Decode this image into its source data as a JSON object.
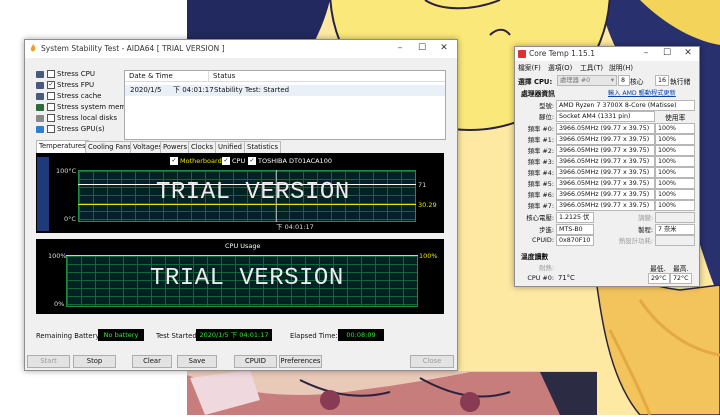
{
  "aida": {
    "title": "System Stability Test - AIDA64  [ TRIAL VERSION ]",
    "stress": [
      {
        "label": "Stress CPU",
        "checked": false
      },
      {
        "label": "Stress FPU",
        "checked": true
      },
      {
        "label": "Stress cache",
        "checked": false
      },
      {
        "label": "Stress system memory",
        "checked": false
      },
      {
        "label": "Stress local disks",
        "checked": false
      },
      {
        "label": "Stress GPU(s)",
        "checked": false
      }
    ],
    "table": {
      "col_date": "Date & Time",
      "col_status": "Status",
      "row_date": "2020/1/5",
      "row_time": "下 04:01:17",
      "row_status": "Stability Test: Started"
    },
    "tabs": [
      "Temperatures",
      "Cooling Fans",
      "Voltages",
      "Powers",
      "Clocks",
      "Unified",
      "Statistics"
    ],
    "temp_graph": {
      "legend": [
        "Motherboard",
        "CPU",
        "TOSHIBA DT01ACA100"
      ],
      "ymax": "100°C",
      "ymin": "0°C",
      "watermark": "TRIAL VERSION",
      "time": "下 04:01:17",
      "val1": "71",
      "val2": "30.29"
    },
    "cpu_graph": {
      "title": "CPU Usage",
      "ymax": "100%",
      "ymin": "0%",
      "right": "100%",
      "watermark": "TRIAL VERSION"
    },
    "bottom": {
      "battery_label": "Remaining Battery:",
      "battery_value": "No battery",
      "started_label": "Test Started:",
      "started_value": "2020/1/5   下 04:01:17",
      "elapsed_label": "Elapsed Time:",
      "elapsed_value": "00:08:09"
    },
    "buttons": {
      "start": "Start",
      "stop": "Stop",
      "clear": "Clear",
      "save": "Save",
      "cpuid": "CPUID",
      "prefs": "Preferences",
      "close": "Close"
    }
  },
  "coretemp": {
    "title": "Core Temp 1.15.1",
    "menu": [
      "檔案(F)",
      "選項(O)",
      "工具(T)",
      "說明(H)"
    ],
    "select_cpu_label": "選擇 CPU:",
    "processor_value": "處理器 #0",
    "cores": "8",
    "cores_label": "核心",
    "threads": "16",
    "threads_label": "執行緒",
    "proc_info_label": "處理器資訊",
    "driver_link": "輸入 AMD 驅動程式更新",
    "model_label": "型號:",
    "model_value": "AMD Ryzen 7 3700X 8-Core (Matisse)",
    "socket_label": "腳位:",
    "socket_value": "Socket AM4 (1331 pin)",
    "usage_label": "使用率",
    "freqs": [
      {
        "label": "頻率 #0:",
        "value": "3966.05MHz (99.77 x 39.75)",
        "usage": "100%"
      },
      {
        "label": "頻率 #1:",
        "value": "3966.05MHz (99.77 x 39.75)",
        "usage": "100%"
      },
      {
        "label": "頻率 #2:",
        "value": "3966.05MHz (99.77 x 39.75)",
        "usage": "100%"
      },
      {
        "label": "頻率 #3:",
        "value": "3966.05MHz (99.77 x 39.75)",
        "usage": "100%"
      },
      {
        "label": "頻率 #4:",
        "value": "3966.05MHz (99.77 x 39.75)",
        "usage": "100%"
      },
      {
        "label": "頻率 #5:",
        "value": "3966.05MHz (99.77 x 39.75)",
        "usage": "100%"
      },
      {
        "label": "頻率 #6:",
        "value": "3966.05MHz (99.77 x 39.75)",
        "usage": "100%"
      },
      {
        "label": "頻率 #7:",
        "value": "3966.05MHz (99.77 x 39.75)",
        "usage": "100%"
      }
    ],
    "voltage_label": "核心電壓:",
    "voltage_value": "1.2125 伏",
    "modulation_label": "調變:",
    "stepping_label": "步進:",
    "stepping_value": "MTS-B0",
    "process_label": "製程:",
    "process_value": "7 奈米",
    "cpuid_label": "CPUID:",
    "cpuid_value": "0x870F10",
    "tdp_label": "熱設計功耗:",
    "temp_section": "溫度讀數",
    "tolerance_label": "耐熱:",
    "min_label": "最低.",
    "max_label": "最高.",
    "cpu0_label": "CPU #0:",
    "cpu0_temp": "71°C",
    "cpu0_min": "29°C",
    "cpu0_max": "72°C"
  }
}
